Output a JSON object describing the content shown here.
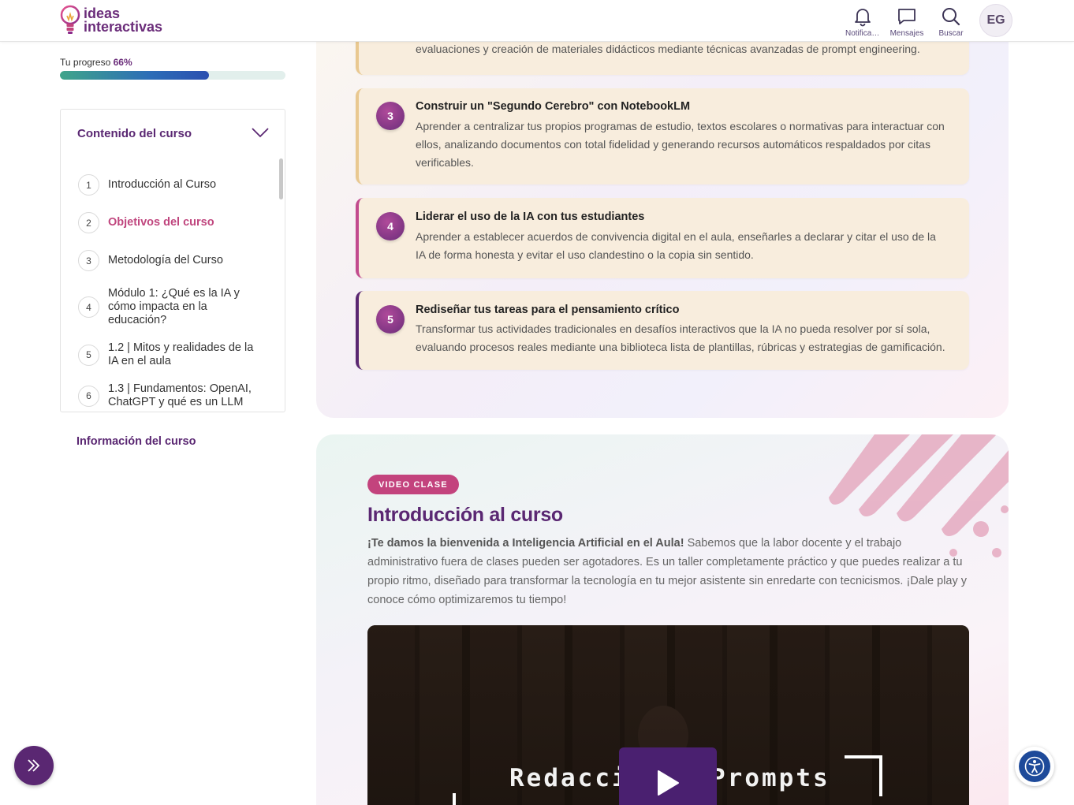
{
  "header": {
    "logo_line1": "ideas",
    "logo_line2": "interactivas",
    "notifications_label": "Notificaciones",
    "messages_label": "Mensajes",
    "search_label": "Buscar",
    "avatar_initials": "EG"
  },
  "progress": {
    "label": "Tu progreso",
    "value_text": "66%",
    "fraction": 0.66
  },
  "toc": {
    "heading": "Contenido del curso",
    "items": [
      {
        "num": "1",
        "label": "Introducción al Curso"
      },
      {
        "num": "2",
        "label": "Objetivos del curso"
      },
      {
        "num": "3",
        "label": "Metodología del Curso"
      },
      {
        "num": "4",
        "label": "Módulo 1: ¿Qué es la IA y cómo impacta en la educación?"
      },
      {
        "num": "5",
        "label": "1.2 | Mitos y realidades de la IA en el aula"
      },
      {
        "num": "6",
        "label": "1.3 | Fundamentos: OpenAI, ChatGPT y qué es un LLM"
      }
    ],
    "active_index": 1
  },
  "course_info_link": "Información del curso",
  "objectives": {
    "card2_tail": "evaluaciones y creación de materiales didácticos mediante técnicas avanzadas de prompt engineering.",
    "cards": [
      {
        "num": "3",
        "title": "Construir un \"Segundo Cerebro\" con NotebookLM",
        "desc": "Aprender a centralizar tus propios programas de estudio, textos escolares o normativas para interactuar con ellos, analizando documentos con total fidelidad y generando recursos automáticos respaldados por citas verificables."
      },
      {
        "num": "4",
        "title": "Liderar el uso de la IA con tus estudiantes",
        "desc": "Aprender a establecer acuerdos de convivencia digital en el aula, enseñarles a declarar y citar el uso de la IA de forma honesta y evitar el uso clandestino o la copia sin sentido."
      },
      {
        "num": "5",
        "title": "Rediseñar tus tareas para el pensamiento crítico",
        "desc": "Transformar tus actividades tradicionales en desafíos interactivos que la IA no pueda resolver por sí sola, evaluando procesos reales mediante una biblioteca lista de plantillas, rúbricas y estrategias de gamificación."
      }
    ],
    "border_colors": [
      "#e9c890",
      "#e9c890",
      "#c24b8e",
      "#5a2772"
    ]
  },
  "video_section": {
    "badge": "VIDEO CLASE",
    "title": "Introducción al curso",
    "intro_bold": "¡Te damos la bienvenida a Inteligencia Artificial en el Aula!",
    "intro_rest": " Sabemos que la labor docente y el trabajo administrativo fuera de clases pueden ser agotadores. Es un taller completamente práctico y que puedes realizar a tu propio ritmo, diseñado para transformar la tecnología en tu mejor asistente sin enredarte con tecnicismos. ¡Dale play y conoce cómo optimizaremos tu tiempo!",
    "video_text_left": "Redacci",
    "video_text_right": "Prompts"
  },
  "colors": {
    "brand_purple": "#5a2772",
    "accent_pink": "#c3437d",
    "card_bg": "#f8eddd"
  }
}
